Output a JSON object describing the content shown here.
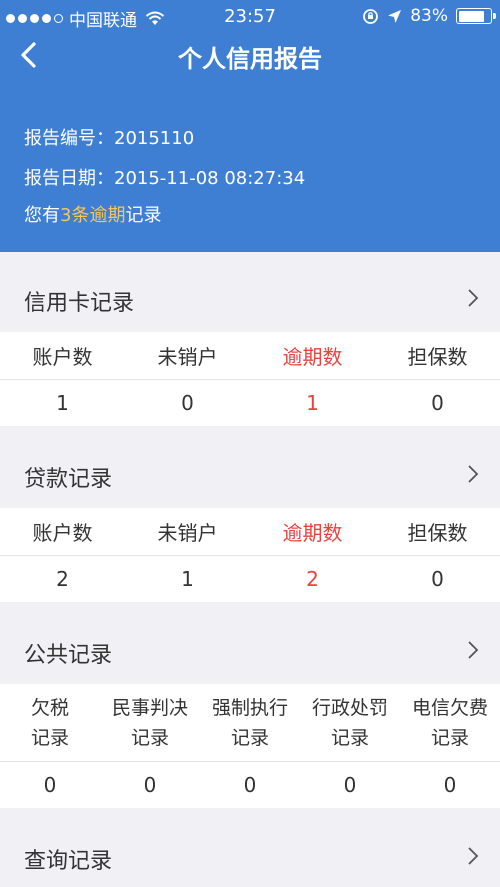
{
  "status_bar": {
    "carrier": "中国联通",
    "time": "23:57",
    "battery": "83%",
    "battery_level": 0.83
  },
  "nav": {
    "title": "个人信用报告"
  },
  "report": {
    "number_label": "报告编号：",
    "number_value": "2015110",
    "date_label": "报告日期：",
    "date_value": "2015-11-08 08:27:34",
    "overdue_prefix": "您有",
    "overdue_highlight": "3条逾期",
    "overdue_suffix": "记录"
  },
  "credit_card": {
    "title": "信用卡记录",
    "headers": [
      "账户数",
      "未销户",
      "逾期数",
      "担保数"
    ],
    "values": [
      "1",
      "0",
      "1",
      "0"
    ]
  },
  "loan": {
    "title": "贷款记录",
    "headers": [
      "账户数",
      "未销户",
      "逾期数",
      "担保数"
    ],
    "values": [
      "2",
      "1",
      "2",
      "0"
    ]
  },
  "public": {
    "title": "公共记录",
    "headers": [
      [
        "欠税",
        "记录"
      ],
      [
        "民事判决",
        "记录"
      ],
      [
        "强制执行",
        "记录"
      ],
      [
        "行政处罚",
        "记录"
      ],
      [
        "电信欠费",
        "记录"
      ]
    ],
    "values": [
      "0",
      "0",
      "0",
      "0",
      "0"
    ]
  },
  "query": {
    "title": "查询记录"
  },
  "colors": {
    "header_bg": "#3f7fd3",
    "highlight": "#f7c55a",
    "overdue_red": "#e8433f",
    "page_bg": "#f0f0f5"
  }
}
